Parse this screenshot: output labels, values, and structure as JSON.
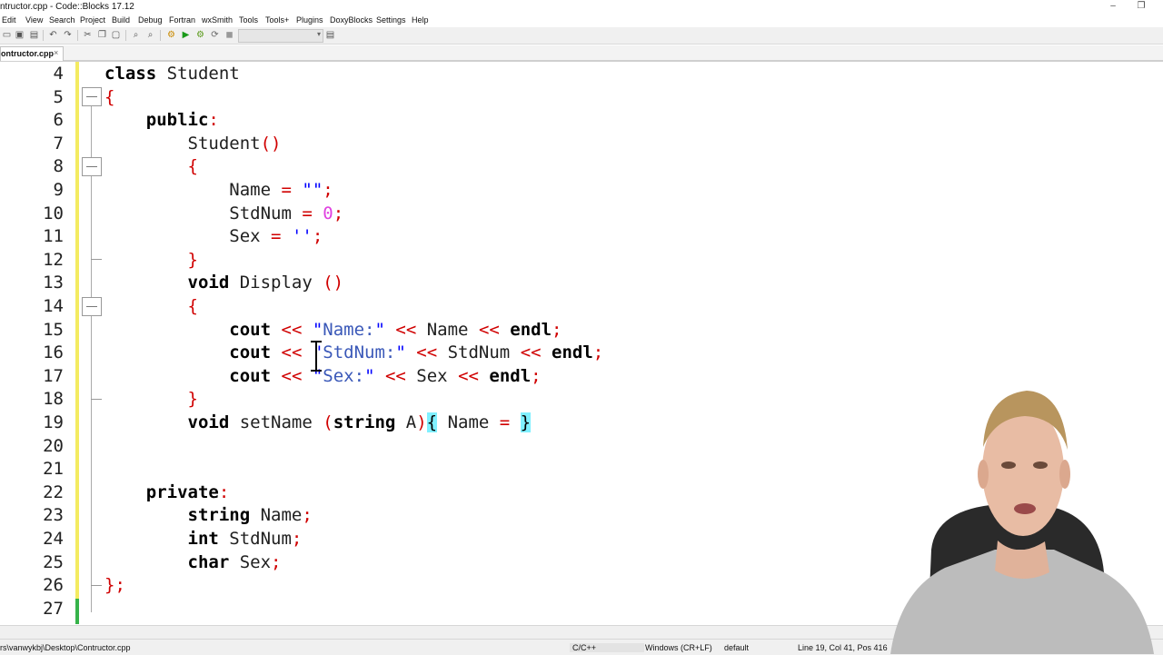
{
  "window": {
    "title": "ntructor.cpp - Code::Blocks 17.12",
    "minimize_glyph": "–",
    "restore_glyph": "❐"
  },
  "menu": [
    "Edit",
    "View",
    "Search",
    "Project",
    "Build",
    "Debug",
    "Fortran",
    "wxSmith",
    "Tools",
    "Tools+",
    "Plugins",
    "DoxyBlocks",
    "Settings",
    "Help"
  ],
  "tabs": [
    {
      "label": "ontructor.cpp",
      "close": "×",
      "active": true
    }
  ],
  "editor": {
    "lines": [
      {
        "n": "4",
        "html": "<span class='kw'>class</span> Student"
      },
      {
        "n": "5",
        "html": "<span class='op'>{</span>"
      },
      {
        "n": "6",
        "html": "    <span class='kw'>public</span><span class='op'>:</span>"
      },
      {
        "n": "7",
        "html": "        Student<span class='op'>()</span>"
      },
      {
        "n": "8",
        "html": "        <span class='op'>{</span>"
      },
      {
        "n": "9",
        "html": "            Name <span class='op'>=</span> <span class='str'>\"\"</span><span class='op'>;</span>"
      },
      {
        "n": "10",
        "html": "            StdNum <span class='op'>=</span> <span class='num'>0</span><span class='op'>;</span>"
      },
      {
        "n": "11",
        "html": "            Sex <span class='op'>=</span> <span class='str'>''</span><span class='op'>;</span>"
      },
      {
        "n": "12",
        "html": "        <span class='op'>}</span>"
      },
      {
        "n": "13",
        "html": "        <span class='kw'>void</span> Display <span class='op'>()</span>"
      },
      {
        "n": "14",
        "html": "        <span class='op'>{</span>"
      },
      {
        "n": "15",
        "html": "            <span class='kw'>cout</span> <span class='op'>&lt;&lt;</span> <span class='str'>\"</span><span class='strw'>Name:</span><span class='str'>\"</span> <span class='op'>&lt;&lt;</span> Name <span class='op'>&lt;&lt;</span> <span class='kw'>endl</span><span class='op'>;</span>"
      },
      {
        "n": "16",
        "html": "            <span class='kw'>cout</span> <span class='op'>&lt;&lt;</span> <span class='str'>\"</span><span class='strw'>StdNum:</span><span class='str'>\"</span> <span class='op'>&lt;&lt;</span> StdNum <span class='op'>&lt;&lt;</span> <span class='kw'>endl</span><span class='op'>;</span>"
      },
      {
        "n": "17",
        "html": "            <span class='kw'>cout</span> <span class='op'>&lt;&lt;</span> <span class='str'>\"</span><span class='strw'>Sex:</span><span class='str'>\"</span> <span class='op'>&lt;&lt;</span> Sex <span class='op'>&lt;&lt;</span> <span class='kw'>endl</span><span class='op'>;</span>"
      },
      {
        "n": "18",
        "html": "        <span class='op'>}</span>"
      },
      {
        "n": "19",
        "html": "        <span class='kw'>void</span> setName <span class='op'>(</span><span class='kw'>string</span> A<span class='op'>)</span><span class='bm'>{</span> Name <span class='op'>=</span> <span class='bm'>}</span>"
      },
      {
        "n": "20",
        "html": ""
      },
      {
        "n": "21",
        "html": ""
      },
      {
        "n": "22",
        "html": "    <span class='kw'>private</span><span class='op'>:</span>"
      },
      {
        "n": "23",
        "html": "        <span class='kw'>string</span> Name<span class='op'>;</span>"
      },
      {
        "n": "24",
        "html": "        <span class='kw'>int</span> StdNum<span class='op'>;</span>"
      },
      {
        "n": "25",
        "html": "        <span class='kw'>char</span> Sex<span class='op'>;</span>"
      },
      {
        "n": "26",
        "html": "<span class='op'>};</span>"
      },
      {
        "n": "27",
        "html": ""
      }
    ]
  },
  "status": {
    "file_path": "rs\\vanwykbj\\Desktop\\Contructor.cpp",
    "language": "C/C++",
    "line_endings": "Windows (CR+LF)",
    "encoding": "default",
    "position": "Line 19, Col 41, Pos 416"
  }
}
